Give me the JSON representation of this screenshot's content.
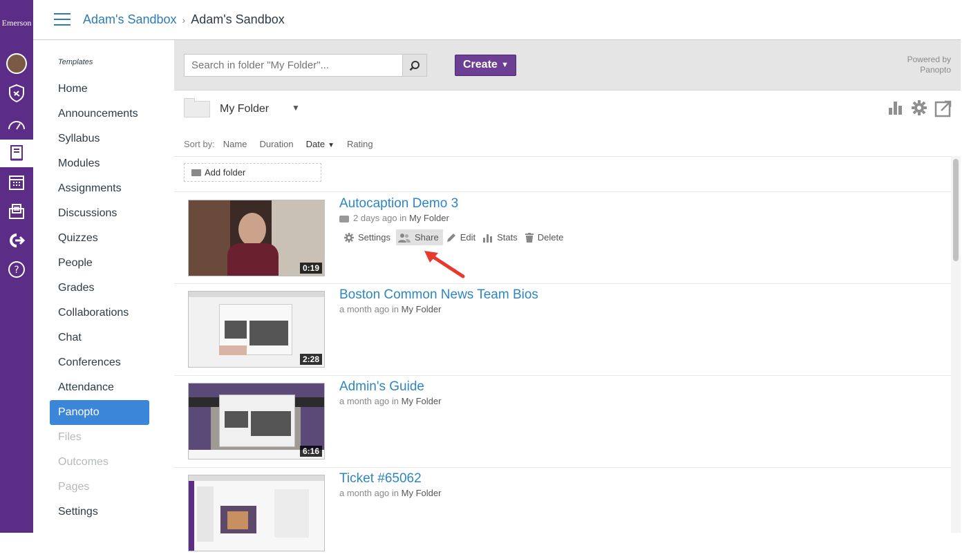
{
  "rail": {
    "brand": "Emerson",
    "icons": [
      "avatar",
      "admin-shield-icon",
      "dashboard-icon",
      "courses-icon",
      "calendar-icon",
      "inbox-icon",
      "commons-icon",
      "help-icon"
    ]
  },
  "header": {
    "breadcrumb": [
      "Adam's Sandbox",
      "Adam's Sandbox"
    ]
  },
  "course_nav": {
    "section_label": "Templates",
    "items": [
      {
        "label": "Home"
      },
      {
        "label": "Announcements"
      },
      {
        "label": "Syllabus"
      },
      {
        "label": "Modules"
      },
      {
        "label": "Assignments"
      },
      {
        "label": "Discussions"
      },
      {
        "label": "Quizzes"
      },
      {
        "label": "People"
      },
      {
        "label": "Grades"
      },
      {
        "label": "Collaborations"
      },
      {
        "label": "Chat"
      },
      {
        "label": "Conferences"
      },
      {
        "label": "Attendance"
      },
      {
        "label": "Panopto"
      },
      {
        "label": "Files"
      },
      {
        "label": "Outcomes"
      },
      {
        "label": "Pages"
      },
      {
        "label": "Settings"
      }
    ],
    "active": "Panopto",
    "disabled": [
      "Files",
      "Outcomes",
      "Pages"
    ]
  },
  "panopto": {
    "search_placeholder": "Search in folder \"My Folder\"...",
    "create_label": "Create",
    "powered_by": [
      "Powered by",
      "Panopto"
    ],
    "folder_name": "My Folder",
    "sort": {
      "label": "Sort by:",
      "options": [
        "Name",
        "Duration",
        "Date",
        "Rating"
      ],
      "active": "Date"
    },
    "add_folder_label": "Add folder",
    "sessions": [
      {
        "title": "Autocaption Demo 3",
        "time": "2 days ago",
        "in_label": "in",
        "folder": "My Folder",
        "duration": "0:19",
        "captioned": true
      },
      {
        "title": "Boston Common News Team Bios",
        "time": "a month ago",
        "in_label": "in",
        "folder": "My Folder",
        "duration": "2:28"
      },
      {
        "title": "Admin's Guide",
        "time": "a month ago",
        "in_label": "in",
        "folder": "My Folder",
        "duration": "6:16"
      },
      {
        "title": "Ticket #65062",
        "time": "a month ago",
        "in_label": "in",
        "folder": "My Folder",
        "duration": ""
      }
    ],
    "actions": [
      "Settings",
      "Share",
      "Edit",
      "Stats",
      "Delete"
    ],
    "highlighted_action": "Share"
  },
  "colors": {
    "rail": "#5b2d86",
    "link": "#2d86c0",
    "create": "#6d3f94",
    "active_nav": "#3b86d9",
    "arrow": "#e8392f"
  }
}
